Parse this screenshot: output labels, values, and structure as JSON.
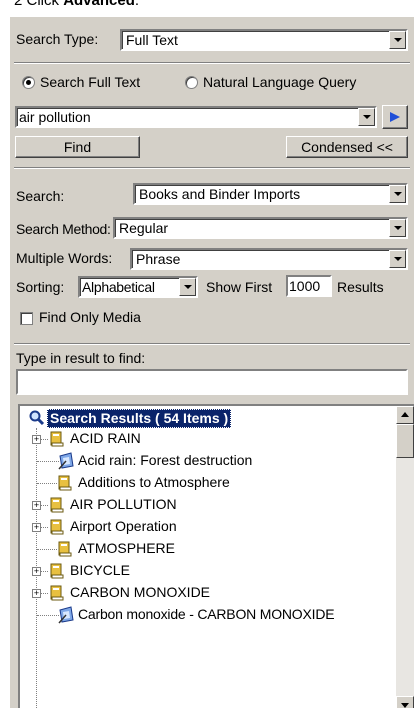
{
  "caption": {
    "prefix": "2  Click ",
    "bold": "Advanced",
    "suffix": "."
  },
  "search_type": {
    "label": "Search Type:",
    "value": "Full Text"
  },
  "mode": {
    "full_text": "Search Full Text",
    "natural": "Natural Language Query",
    "selected": "full_text"
  },
  "query": {
    "value": "air pollution"
  },
  "buttons": {
    "find": "Find",
    "condensed": "Condensed <<"
  },
  "search_in": {
    "label": "Search:",
    "value": "Books and Binder Imports"
  },
  "method": {
    "label": "Search Method:",
    "value": "Regular"
  },
  "words": {
    "label": "Multiple Words:",
    "value": "Phrase"
  },
  "sorting": {
    "label": "Sorting:",
    "value": "Alphabetical",
    "show_first": "Show First",
    "count": "1000",
    "results": "Results"
  },
  "media": {
    "label": "Find Only Media",
    "checked": false
  },
  "filter": {
    "label": "Type in result to find:",
    "value": ""
  },
  "results": {
    "header": "Search Results ( 54 Items )",
    "items": [
      {
        "label": "ACID RAIN",
        "kind": "book",
        "expandable": true
      },
      {
        "label": "Acid rain: Forest destruction",
        "kind": "media",
        "expandable": false
      },
      {
        "label": "Additions to Atmosphere",
        "kind": "book",
        "expandable": false
      },
      {
        "label": "AIR POLLUTION",
        "kind": "book",
        "expandable": true
      },
      {
        "label": "Airport Operation",
        "kind": "book",
        "expandable": true
      },
      {
        "label": "ATMOSPHERE",
        "kind": "book",
        "expandable": false
      },
      {
        "label": "BICYCLE",
        "kind": "book",
        "expandable": true
      },
      {
        "label": "CARBON MONOXIDE",
        "kind": "book",
        "expandable": true
      },
      {
        "label": "Carbon monoxide - CARBON MONOXIDE",
        "kind": "media",
        "expandable": false
      }
    ]
  },
  "colors": {
    "panel": "#d4d0c8",
    "highlight": "#0a246a",
    "play": "#1f4fd8"
  }
}
